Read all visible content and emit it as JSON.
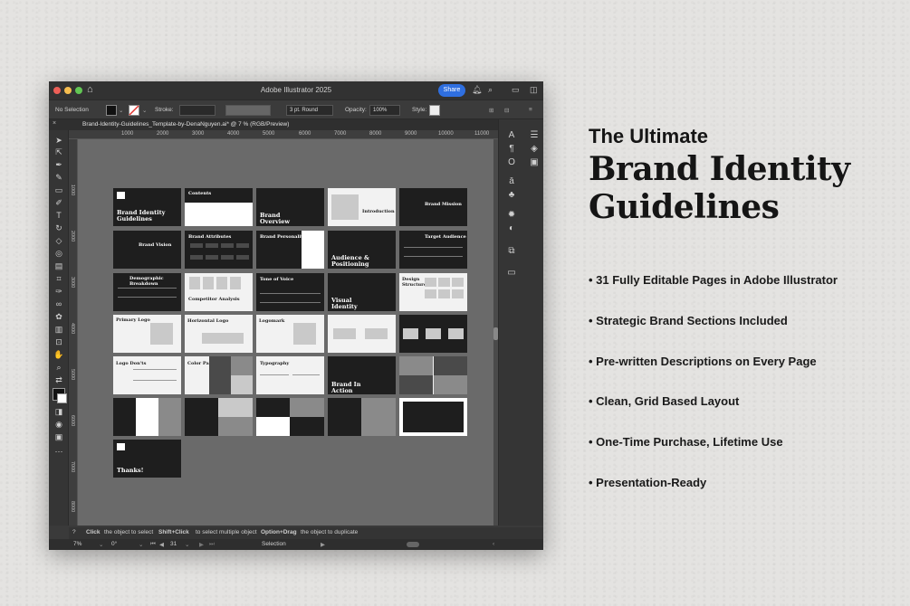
{
  "window": {
    "app_title": "Adobe Illustrator 2025",
    "share_label": "Share",
    "control": {
      "selection": "No Selection",
      "stroke_label": "Stroke:",
      "brush": "3 pt. Round",
      "opacity_label": "Opacity:",
      "opacity_value": "100%",
      "style_label": "Style:"
    },
    "document_tab": "Brand-Identity-Guidelines_Template-by-DenaNguyen.ai* @ 7 % (RGB/Preview)",
    "ruler_top": [
      "1000",
      "2000",
      "3000",
      "4000",
      "5000",
      "6000",
      "7000",
      "8000",
      "9000",
      "10000",
      "11000"
    ],
    "ruler_left": [
      "1000",
      "2000",
      "3000",
      "4000",
      "5000",
      "6000",
      "7000",
      "8000"
    ],
    "hint": {
      "part1_bold": "Click",
      "part1": "the object to select",
      "part2_bold": "Shift+Click",
      "part2": "to select multiple object",
      "part3_bold": "Option+Drag",
      "part3": "the object to duplicate"
    },
    "status": {
      "zoom": "7%",
      "rotation": "0°",
      "artboard_number": "31",
      "mode": "Selection"
    }
  },
  "artboards": {
    "cover_title": "Brand Identity Guidelines",
    "contents": "Contents",
    "brand_overview": "Brand Overview",
    "introduction": "Introduction",
    "brand_mission": "Brand Mission",
    "brand_vision": "Brand Vision",
    "brand_attributes": "Brand Attributes",
    "brand_personality": "Brand Personality",
    "audience_positioning": "Audience & Positioning",
    "target_audience": "Target Audience",
    "demographic_breakdown": "Demographic Breakdown",
    "competitor_analysis": "Competitor Analysis",
    "tone_of_voice": "Tone of Voice",
    "visual_identity": "Visual Identity",
    "design_structure": "Design Structure",
    "primary_logo": "Primary Logo",
    "horizontal_logo": "Horizontal Logo",
    "logomark": "Logomark",
    "logo_usage": "Logo Don'ts",
    "color_palette": "Color Palette",
    "typography": "Typography",
    "brand_in_action": "Brand In Action",
    "thanks": "Thanks!"
  },
  "marketing": {
    "subtitle": "The Ultimate",
    "title": "Brand Identity Guidelines",
    "bullets": [
      "• 31 Fully Editable Pages in Adobe Illustrator",
      "• Strategic Brand Sections Included",
      "• Pre-written Descriptions on Every Page",
      "• Clean, Grid Based Layout",
      "• One-Time Purchase, Lifetime Use",
      "• Presentation-Ready"
    ]
  }
}
